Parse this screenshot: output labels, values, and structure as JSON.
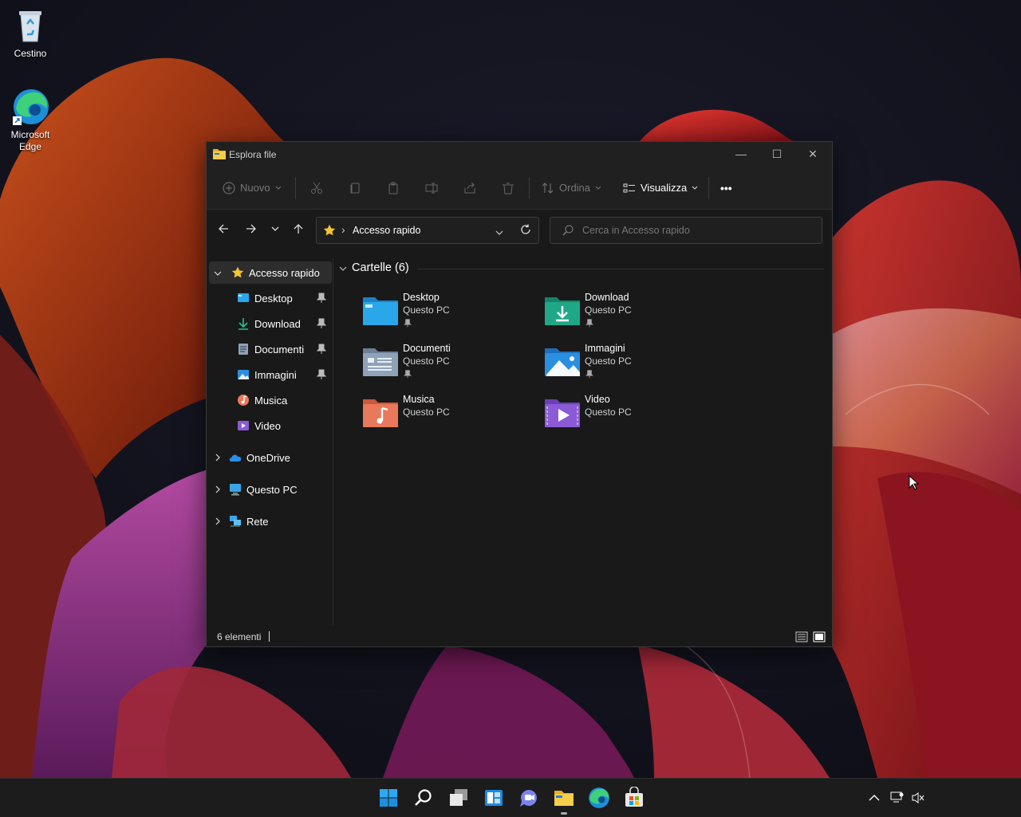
{
  "desktop": {
    "icons": [
      {
        "label": "Cestino"
      },
      {
        "label": "Microsoft Edge"
      }
    ]
  },
  "window": {
    "title": "Esplora file",
    "controls": {
      "minimize": "—",
      "maximize": "☐",
      "close": "✕"
    }
  },
  "toolbar": {
    "new_label": "Nuovo",
    "sort_label": "Ordina",
    "view_label": "Visualizza",
    "more_label": "•••"
  },
  "address": {
    "location": "Accesso rapido",
    "separator": "›"
  },
  "search": {
    "placeholder": "Cerca in Accesso rapido"
  },
  "sidebar": {
    "quick_access": "Accesso rapido",
    "items": [
      {
        "label": "Desktop",
        "pinned": true
      },
      {
        "label": "Download",
        "pinned": true
      },
      {
        "label": "Documenti",
        "pinned": true
      },
      {
        "label": "Immagini",
        "pinned": true
      },
      {
        "label": "Musica",
        "pinned": false
      },
      {
        "label": "Video",
        "pinned": false
      }
    ],
    "onedrive": "OneDrive",
    "this_pc": "Questo PC",
    "network": "Rete"
  },
  "content": {
    "group_header": "Cartelle (6)",
    "folders": [
      {
        "name": "Desktop",
        "location": "Questo PC",
        "pinned": true,
        "color": "#2aa7e8"
      },
      {
        "name": "Download",
        "location": "Questo PC",
        "pinned": true,
        "color": "#1fa887"
      },
      {
        "name": "Documenti",
        "location": "Questo PC",
        "pinned": true,
        "color": "#8fa2b8"
      },
      {
        "name": "Immagini",
        "location": "Questo PC",
        "pinned": true,
        "color": "#2b8fe0"
      },
      {
        "name": "Musica",
        "location": "Questo PC",
        "pinned": false,
        "color": "#e9795a"
      },
      {
        "name": "Video",
        "location": "Questo PC",
        "pinned": false,
        "color": "#8b5ad6"
      }
    ]
  },
  "status": {
    "count": "6 elementi"
  },
  "colors": {
    "accent": "#4cc2ff",
    "star": "#f6c431"
  }
}
